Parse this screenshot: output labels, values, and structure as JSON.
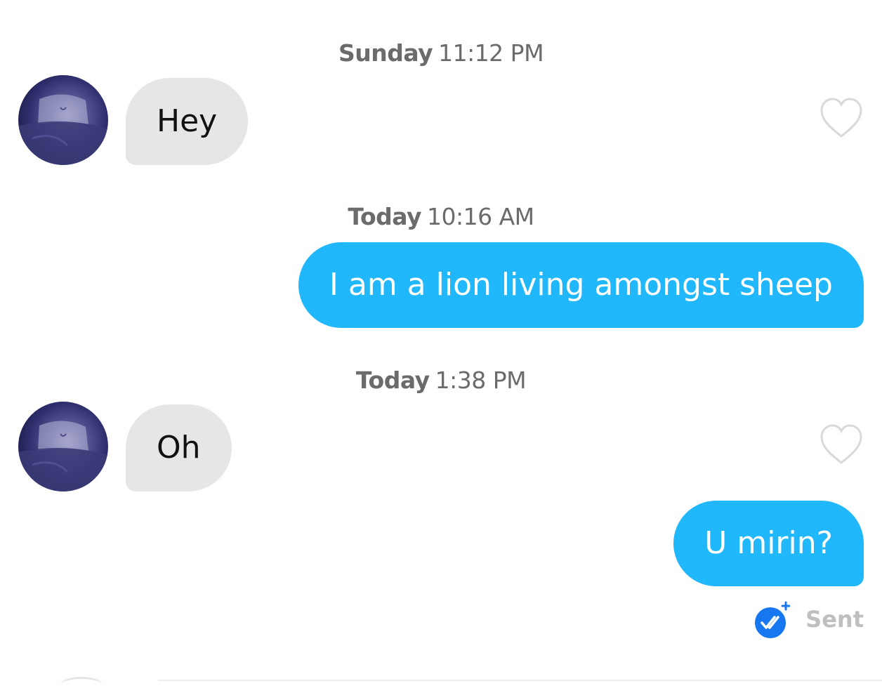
{
  "messages": [
    {
      "timestamp": {
        "day": "Sunday",
        "time": "11:12 PM"
      },
      "direction": "incoming",
      "text": "Hey",
      "liked": false
    },
    {
      "timestamp": {
        "day": "Today",
        "time": "10:16 AM"
      },
      "direction": "outgoing",
      "text": "I am a lion living amongst sheep"
    },
    {
      "timestamp": {
        "day": "Today",
        "time": "1:38 PM"
      },
      "direction": "incoming",
      "text": "Oh",
      "liked": false
    },
    {
      "direction": "outgoing",
      "text": "U mirin?"
    }
  ],
  "status": {
    "label": "Sent",
    "icon": "read-receipt-icon"
  },
  "colors": {
    "outgoing_bubble": "#21b8fb",
    "incoming_bubble": "#e6e6e6",
    "timestamp_text": "#6b6b6b",
    "heart_outline": "#d9d9d9",
    "receipt_icon": "#1677f0"
  }
}
